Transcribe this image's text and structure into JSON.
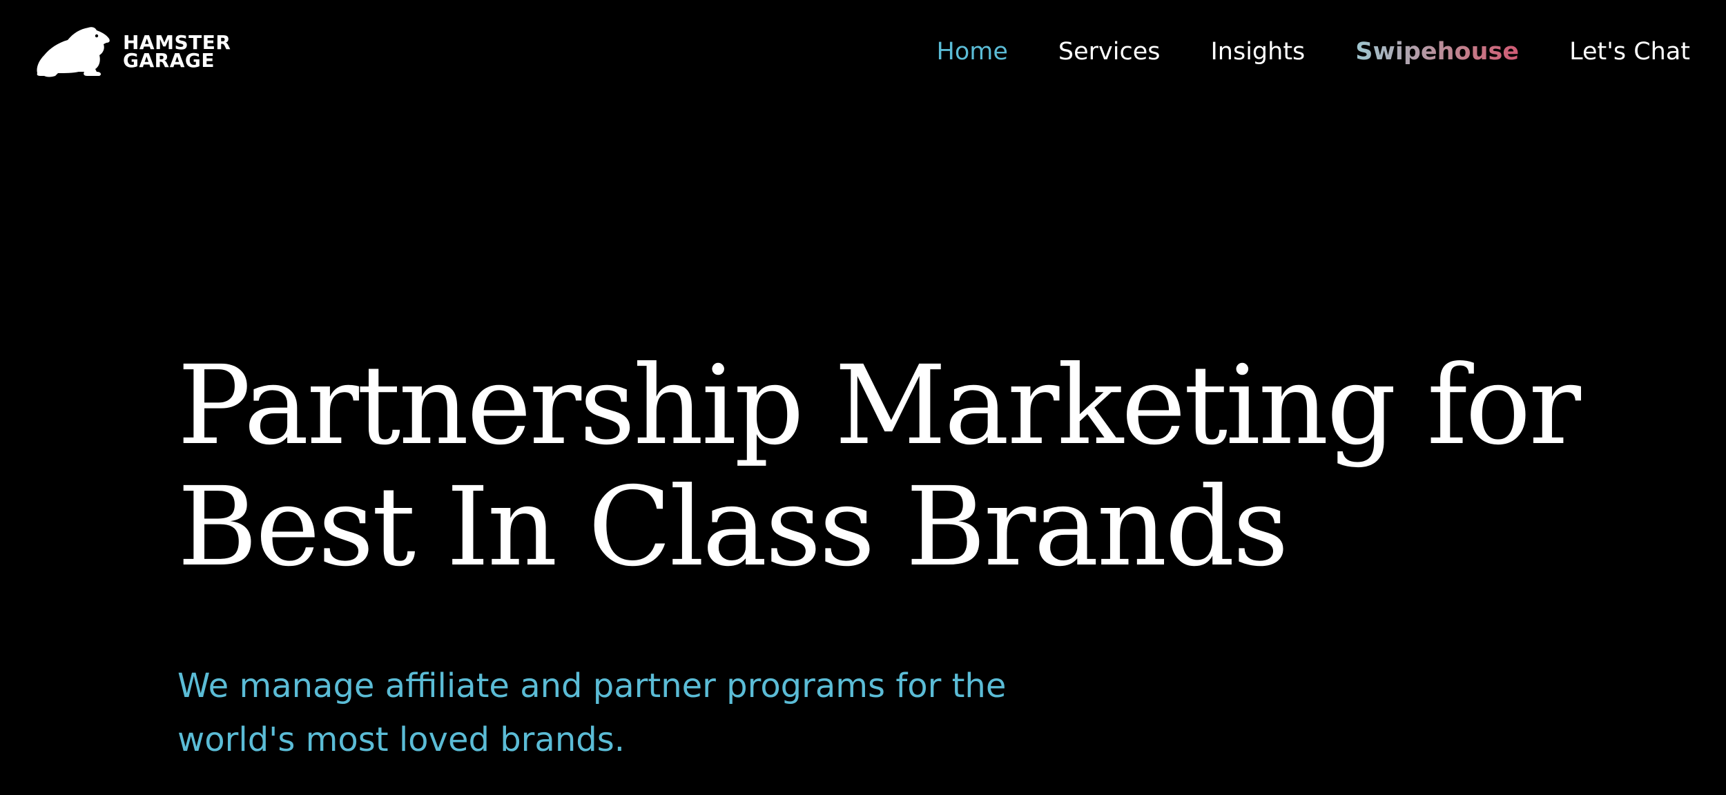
{
  "colors": {
    "background": "#000000",
    "text": "#ffffff",
    "accent": "#5bbcd6",
    "swipehouse_gradient_start": "#9ec6cf",
    "swipehouse_gradient_end": "#d05a74"
  },
  "header": {
    "logo": {
      "icon": "hamster-icon",
      "line1": "HAMSTER",
      "line2": "GARAGE"
    },
    "nav": [
      {
        "label": "Home",
        "active": true
      },
      {
        "label": "Services",
        "active": false
      },
      {
        "label": "Insights",
        "active": false
      },
      {
        "label": "Swipehouse",
        "active": false
      },
      {
        "label": "Let's Chat",
        "active": false
      }
    ]
  },
  "hero": {
    "title_line1": "Partnership Marketing for",
    "title_line2": "Best In Class Brands",
    "subtitle_line1": "We manage affiliate and partner programs for the",
    "subtitle_line2": "world's most loved brands."
  }
}
